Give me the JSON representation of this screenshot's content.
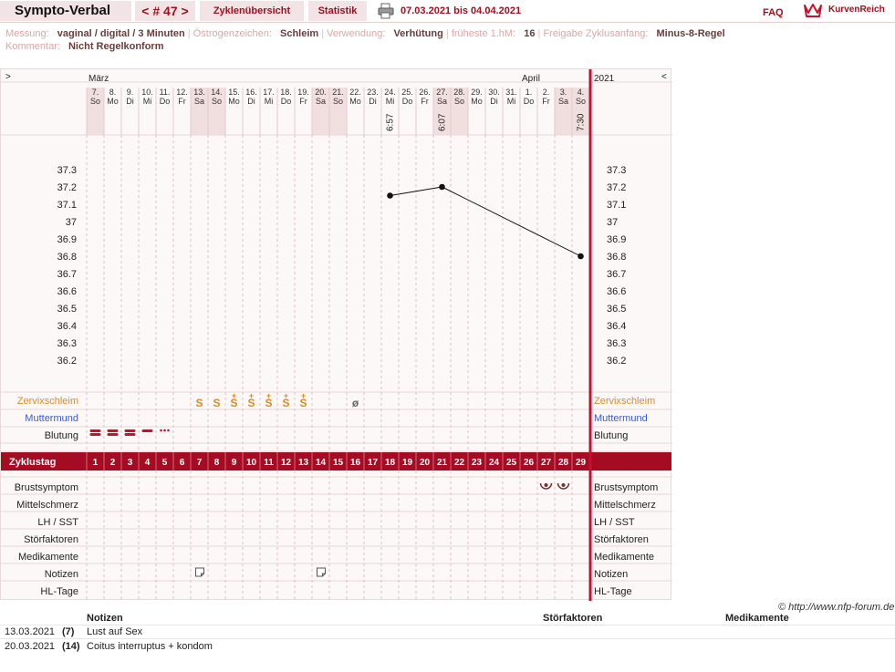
{
  "header": {
    "app_title": "Sympto-Verbal",
    "cycle_nav": "< # 47 >",
    "tab_overview": "Zyklenübersicht",
    "tab_stats": "Statistik",
    "date_range": "07.03.2021 bis 04.04.2021",
    "faq": "FAQ",
    "brand": "KurvenReich",
    "colors": {
      "accent": "#a0101e",
      "tab_bg": "#f2e4e4"
    }
  },
  "info": {
    "measure_label": "Messung:",
    "measure_value": "vaginal / digital / 3 Minuten",
    "estrogen_label": "Östrogenzeichen:",
    "estrogen_value": "Schleim",
    "usage_label": "Verwendung:",
    "usage_value": "Verhütung",
    "earliest_label": "früheste 1.hM:",
    "earliest_value": "16",
    "release_label": "Freigabe Zyklusanfang:",
    "release_value": "Minus-8-Regel",
    "comment_label": "Kommentar:",
    "comment_value": "Nicht Regelkonform"
  },
  "chart_data": {
    "type": "line",
    "year": "2021",
    "nav_left": ">",
    "nav_right": "<",
    "months": [
      {
        "name": "März",
        "at_day": 1
      },
      {
        "name": "April",
        "at_day": 26
      }
    ],
    "days": [
      {
        "d": "7.",
        "w": "So",
        "we": true
      },
      {
        "d": "8.",
        "w": "Mo"
      },
      {
        "d": "9.",
        "w": "Di"
      },
      {
        "d": "10.",
        "w": "Mi"
      },
      {
        "d": "11.",
        "w": "Do"
      },
      {
        "d": "12.",
        "w": "Fr"
      },
      {
        "d": "13.",
        "w": "Sa",
        "we": true
      },
      {
        "d": "14.",
        "w": "So",
        "we": true
      },
      {
        "d": "15.",
        "w": "Mo"
      },
      {
        "d": "16.",
        "w": "Di"
      },
      {
        "d": "17.",
        "w": "Mi"
      },
      {
        "d": "18.",
        "w": "Do"
      },
      {
        "d": "19.",
        "w": "Fr"
      },
      {
        "d": "20.",
        "w": "Sa",
        "we": true
      },
      {
        "d": "21.",
        "w": "So",
        "we": true
      },
      {
        "d": "22.",
        "w": "Mo"
      },
      {
        "d": "23.",
        "w": "Di"
      },
      {
        "d": "24.",
        "w": "Mi"
      },
      {
        "d": "25.",
        "w": "Do"
      },
      {
        "d": "26.",
        "w": "Fr"
      },
      {
        "d": "27.",
        "w": "Sa",
        "we": true
      },
      {
        "d": "28.",
        "w": "So",
        "we": true
      },
      {
        "d": "29.",
        "w": "Mo"
      },
      {
        "d": "30.",
        "w": "Di"
      },
      {
        "d": "31.",
        "w": "Mi"
      },
      {
        "d": "1.",
        "w": "Do"
      },
      {
        "d": "2.",
        "w": "Fr"
      },
      {
        "d": "3.",
        "w": "Sa",
        "we": true
      },
      {
        "d": "4.",
        "w": "So",
        "we": true
      }
    ],
    "times": [
      {
        "day": 18,
        "t": "6:57"
      },
      {
        "day": 21,
        "t": "6:07"
      },
      {
        "day": 29,
        "t": "7:30"
      }
    ],
    "y_ticks": [
      "37.3",
      "37.2",
      "37.1",
      "37",
      "36.9",
      "36.8",
      "36.7",
      "36.6",
      "36.5",
      "36.4",
      "36.3",
      "36.2"
    ],
    "ylim": [
      36.2,
      37.3
    ],
    "temperature": [
      {
        "day": 18,
        "value": 37.15
      },
      {
        "day": 21,
        "value": 37.2
      },
      {
        "day": 29,
        "value": 36.8
      }
    ],
    "row_labels": {
      "cervix": "Zervixschleim",
      "cervix_color": "#e08a1e",
      "muttermund": "Muttermund",
      "muttermund_color": "#3a5bd0",
      "bleeding": "Blutung",
      "cycleday": "Zyklustag",
      "breast": "Brustsymptom",
      "mittel": "Mittelschmerz",
      "lh": "LH / SST",
      "stoer": "Störfaktoren",
      "med": "Medikamente",
      "notes": "Notizen",
      "hl": "HL-Tage"
    },
    "cervix": [
      {
        "day": 7,
        "sym": "S",
        "plus": false
      },
      {
        "day": 8,
        "sym": "S",
        "plus": false
      },
      {
        "day": 9,
        "sym": "S",
        "plus": true
      },
      {
        "day": 10,
        "sym": "S",
        "plus": true
      },
      {
        "day": 11,
        "sym": "S",
        "plus": true
      },
      {
        "day": 12,
        "sym": "S",
        "plus": true
      },
      {
        "day": 13,
        "sym": "S",
        "plus": true
      },
      {
        "day": 16,
        "sym": "ø",
        "plus": false,
        "gray": true
      }
    ],
    "bleeding": [
      {
        "day": 1,
        "kind": "heavy"
      },
      {
        "day": 2,
        "kind": "heavy"
      },
      {
        "day": 3,
        "kind": "heavy"
      },
      {
        "day": 4,
        "kind": "medium"
      },
      {
        "day": 5,
        "kind": "spot"
      }
    ],
    "breast_days": [
      27,
      28
    ],
    "note_days": [
      7,
      14
    ],
    "cycle_day_count": 29
  },
  "notes_table": {
    "col_notes": "Notizen",
    "col_stoer": "Störfaktoren",
    "col_med": "Medikamente",
    "copyright": "© http://www.nfp-forum.de",
    "rows": [
      {
        "date": "13.03.2021",
        "day": "(7)",
        "note": "Lust auf Sex"
      },
      {
        "date": "20.03.2021",
        "day": "(14)",
        "note": "Coitus interruptus + kondom"
      }
    ]
  }
}
